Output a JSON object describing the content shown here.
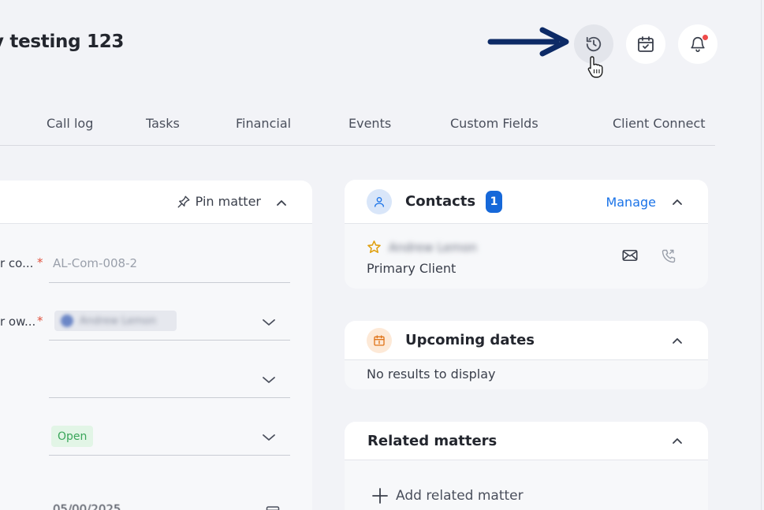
{
  "header": {
    "title": "y testing 123",
    "icons": [
      "history-icon",
      "calendar-check-icon",
      "bell-icon"
    ],
    "notification_dot_color": "#ef4a4a"
  },
  "tabs": [
    {
      "label": "Call log"
    },
    {
      "label": "Tasks"
    },
    {
      "label": "Financial"
    },
    {
      "label": "Events"
    },
    {
      "label": "Custom Fields"
    },
    {
      "label": "Client Connect"
    }
  ],
  "matter_panel": {
    "pin_label": "Pin matter",
    "fields": [
      {
        "label": "r co...",
        "required": "*",
        "placeholder": "AL-Com-008-2"
      },
      {
        "label": "r ow...",
        "required": "*",
        "value": "Andrew Lemon"
      },
      {
        "label": "",
        "value": ""
      },
      {
        "label": "",
        "status": "Open"
      },
      {
        "label": "",
        "value": "05/00/2025"
      }
    ]
  },
  "contacts": {
    "title": "Contacts",
    "count": "1",
    "manage_label": "Manage",
    "items": [
      {
        "name": "Andrew Lemon",
        "role": "Primary Client"
      }
    ]
  },
  "upcoming_dates": {
    "title": "Upcoming dates",
    "empty_text": "No results to display"
  },
  "related_matters": {
    "title": "Related matters",
    "add_label": "Add related matter"
  },
  "colors": {
    "accent": "#1a73e8",
    "badge": "#1668d9",
    "status_open_bg": "#e2f5e6",
    "status_open_text": "#3aa65a",
    "annotation_arrow": "#0d2a66"
  }
}
